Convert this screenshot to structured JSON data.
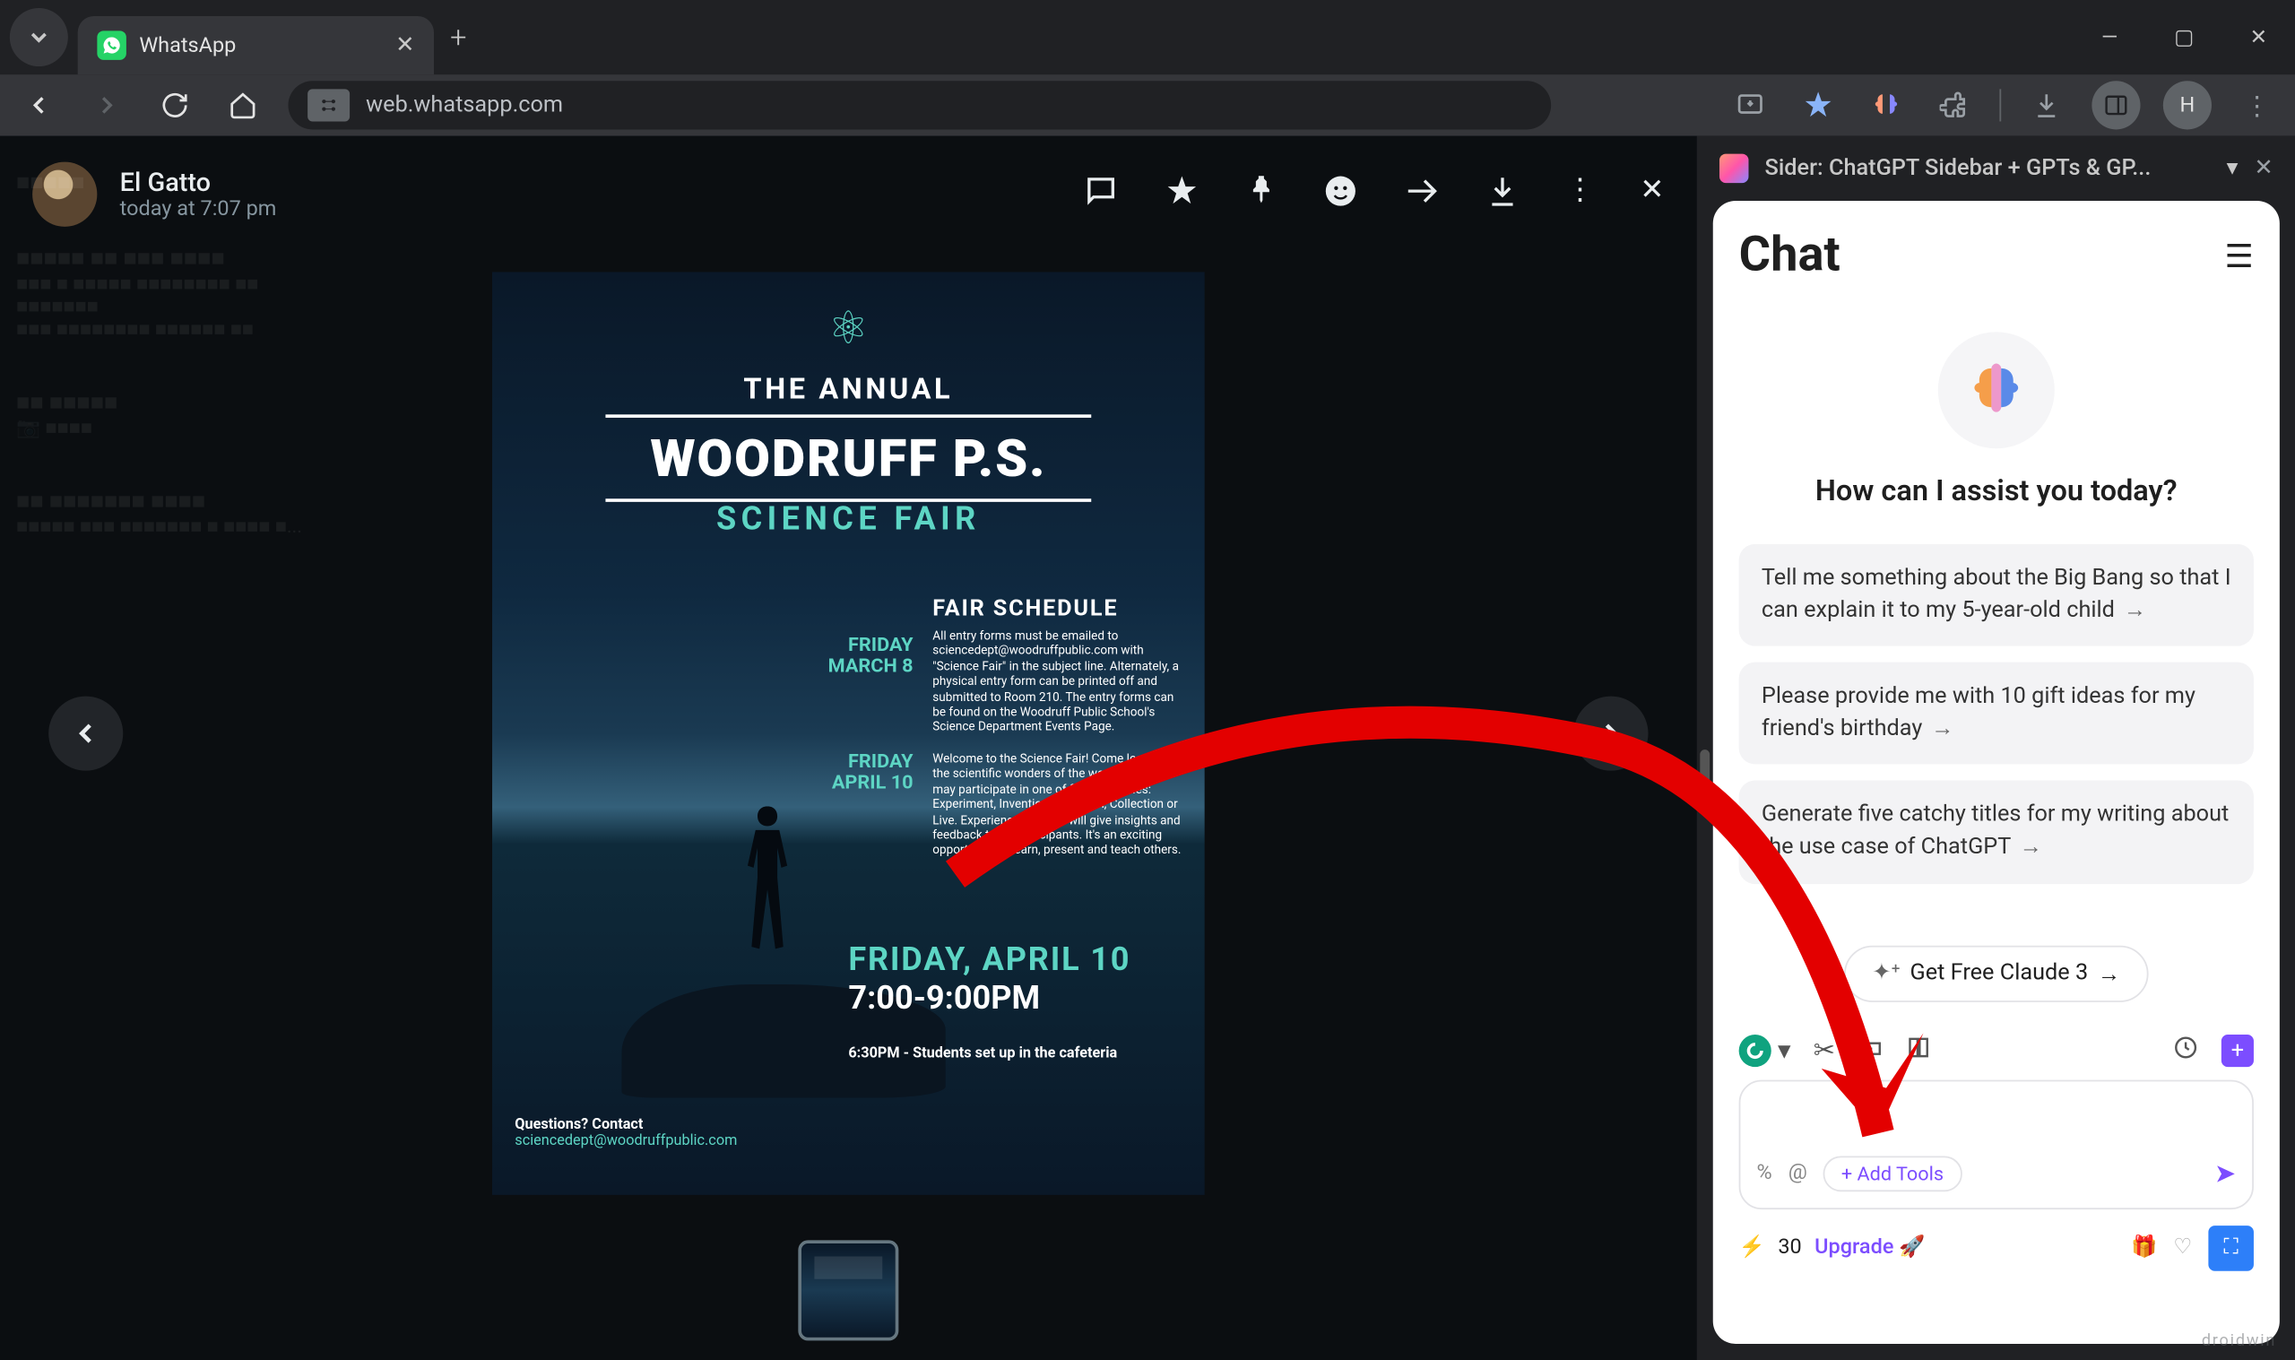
{
  "browser": {
    "tab_title": "WhatsApp",
    "url": "web.whatsapp.com",
    "window_controls": {
      "min": "—",
      "max": "▢",
      "close": "✕"
    }
  },
  "media_viewer": {
    "sender_name": "El Gatto",
    "timestamp": "today at 7:07 pm"
  },
  "poster": {
    "annual": "THE ANNUAL",
    "title": "WOODRUFF P.S.",
    "subtitle": "SCIENCE FAIR",
    "schedule_heading": "FAIR SCHEDULE",
    "date1_line1": "FRIDAY",
    "date1_line2": "MARCH 8",
    "date2_line1": "FRIDAY",
    "date2_line2": "APRIL 10",
    "para1": "All entry forms must be emailed to sciencedept@woodruffpublic.com with \"Science Fair\" in the subject line. Alternately, a physical entry form can be printed off and submitted to Room 210. The entry forms can be found on the Woodruff Public School's Science Department Events Page.",
    "para2": "Welcome to the Science Fair! Come learn about the scientific wonders of the world. Students may participate in one of five categories: Experiment, Invention, Research, Collection or Live. Experienced judges will give insights and feedback to all participants. It's an exciting opportunity to learn, present and teach others.",
    "event_day": "FRIDAY, APRIL 10",
    "event_time": "7:00-9:00PM",
    "setup_note": "6:30PM - Students set up in the cafeteria",
    "contact_q": "Questions? Contact",
    "contact_email": "sciencedept@woodruffpublic.com"
  },
  "sider": {
    "panel_title": "Sider: ChatGPT Sidebar + GPTs & GP...",
    "chat_heading": "Chat",
    "assist_prompt": "How can I assist you today?",
    "suggestions": [
      "Tell me something about the Big Bang so that I can explain it to my 5-year-old child",
      "Please provide me with 10 gift ideas for my friend's birthday",
      "Generate five catchy titles for my writing about the use case of ChatGPT"
    ],
    "claude_cta": "Get Free Claude 3",
    "add_tools": "+ Add Tools",
    "credits": "30",
    "upgrade": "Upgrade"
  },
  "watermark": "droidwin"
}
